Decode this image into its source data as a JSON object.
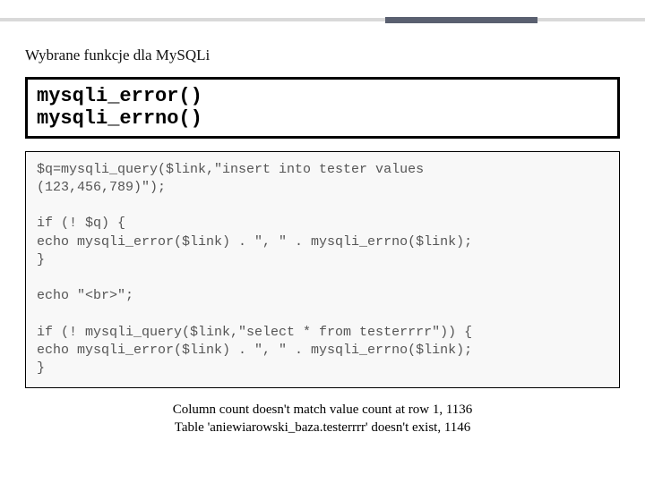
{
  "subtitle": "Wybrane funkcje dla MySQLi",
  "funcs": {
    "line1": "mysqli_error()",
    "line2": "mysqli_errno()"
  },
  "code": "$q=mysqli_query($link,\"insert into tester values\n(123,456,789)\");\n\nif (! $q) {\necho mysqli_error($link) . \", \" . mysqli_errno($link);\n}\n\necho \"<br>\";\n\nif (! mysqli_query($link,\"select * from testerrrr\")) {\necho mysqli_error($link) . \", \" . mysqli_errno($link);\n}",
  "output": {
    "line1": "Column count doesn't match value count at row 1, 1136",
    "line2": "Table 'aniewiarowski_baza.testerrrr' doesn't exist, 1146"
  }
}
